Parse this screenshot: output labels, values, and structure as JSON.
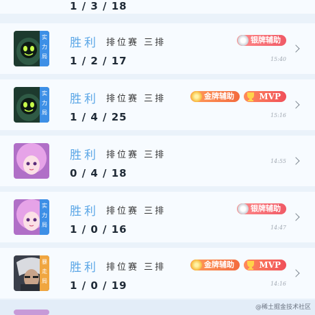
{
  "top_row": {
    "kda": "1 / 3 / 18"
  },
  "matches": [
    {
      "result": "胜利",
      "mode": "排位赛 三排",
      "kda": "1 / 2 / 17",
      "time": "15:40",
      "tag": "实力局",
      "badges": [
        {
          "type": "silver",
          "label": "银牌辅助"
        }
      ]
    },
    {
      "result": "胜利",
      "mode": "排位赛 三排",
      "kda": "1 / 4 / 25",
      "time": "15:16",
      "tag": "实力局",
      "badges": [
        {
          "type": "gold",
          "label": "金牌辅助"
        },
        {
          "type": "mvp",
          "label": "MVP"
        }
      ]
    },
    {
      "result": "胜利",
      "mode": "排位赛 三排",
      "kda": "0 / 4 / 18",
      "time": "14:55",
      "tag": "",
      "badges": []
    },
    {
      "result": "胜利",
      "mode": "排位赛 三排",
      "kda": "1 / 0 / 16",
      "time": "14:47",
      "tag": "实力局",
      "badges": [
        {
          "type": "silver",
          "label": "银牌辅助"
        }
      ]
    },
    {
      "result": "胜利",
      "mode": "排位赛 三排",
      "kda": "1 / 0 / 19",
      "time": "14:16",
      "tag": "暴走局",
      "badges": [
        {
          "type": "gold",
          "label": "金牌辅助"
        },
        {
          "type": "mvp",
          "label": "MVP"
        }
      ]
    }
  ],
  "watermark": "@稀土掘金技术社区",
  "colors": {
    "win": "#5aa6e6",
    "tag_blue": "#3d8fe6",
    "tag_gold": "#f0a640",
    "background": "#eaf2fa"
  }
}
